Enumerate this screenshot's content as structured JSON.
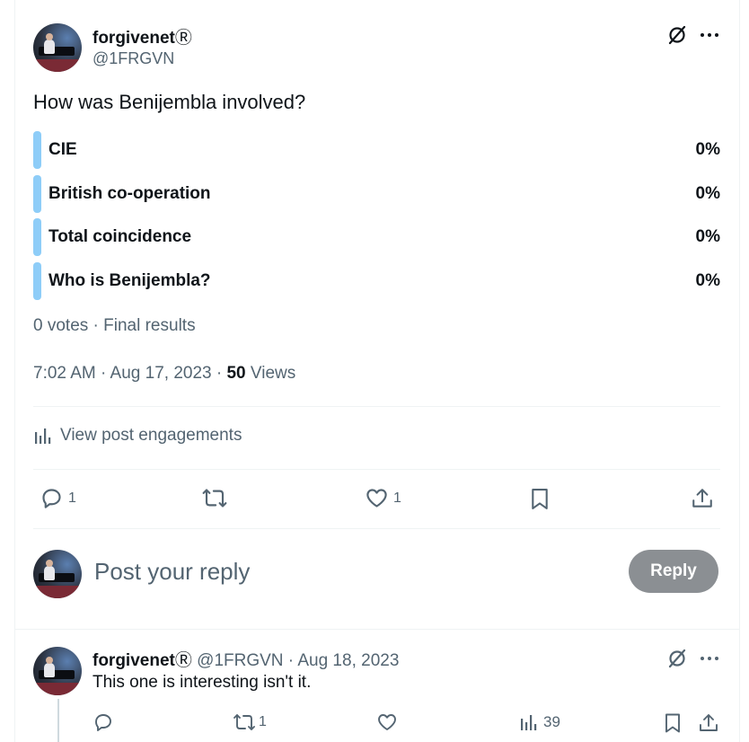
{
  "post": {
    "display_name": "forgivenet",
    "registered_mark": "Ⓡ",
    "handle": "@1FRGVN",
    "text": "How was Benijembla involved?",
    "poll": [
      {
        "label": "CIE",
        "percent": "0%"
      },
      {
        "label": "British co-operation",
        "percent": "0%"
      },
      {
        "label": "Total coincidence",
        "percent": "0%"
      },
      {
        "label": "Who is Benijembla?",
        "percent": "0%"
      }
    ],
    "poll_summary": "0 votes · Final results",
    "time": "7:02 AM · Aug 17, 2023 · ",
    "views_count": "50",
    "views_label": " Views",
    "engagements_link": "View post engagements",
    "actions": {
      "replies": "1",
      "reposts": "",
      "likes": "1"
    }
  },
  "composer": {
    "placeholder": "Post your reply",
    "reply_button": "Reply"
  },
  "reply": {
    "display_name": "forgivenet",
    "registered_mark": "Ⓡ",
    "handle_date": "@1FRGVN · Aug 18, 2023",
    "text": "This one is interesting isn't it.",
    "actions": {
      "replies": "",
      "reposts": "1",
      "likes": "",
      "views": "39"
    }
  },
  "colors": {
    "accent_poll": "#8ecdf8",
    "text_gray": "#536471",
    "reply_button_bg": "#8b8f93"
  }
}
